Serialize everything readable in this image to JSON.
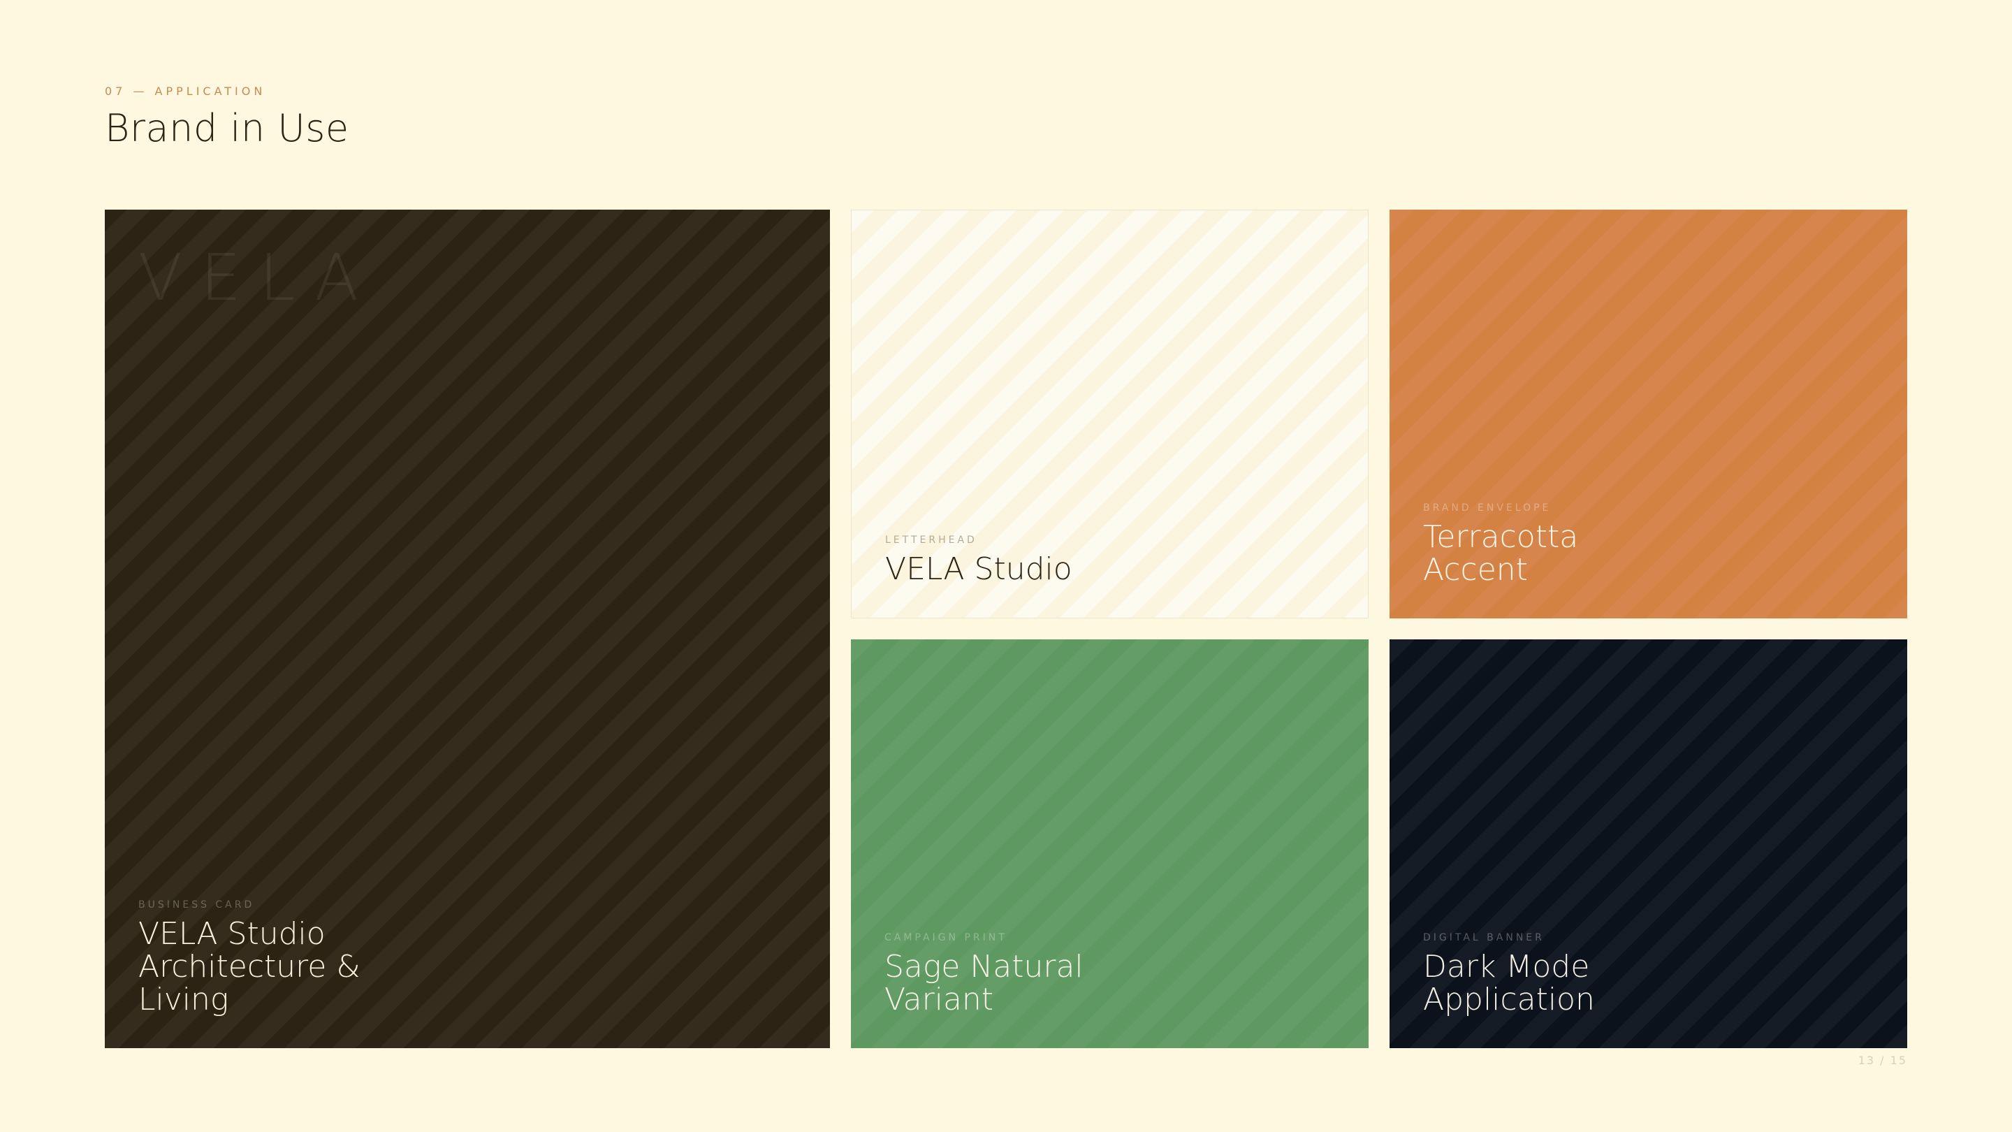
{
  "section": {
    "eyebrow": "07 — APPLICATION",
    "title": "Brand in Use"
  },
  "cards": {
    "business_card": {
      "watermark": "VELA",
      "label": "BUSINESS CARD",
      "title": "VELA Studio\nArchitecture &\nLiving",
      "background": "#2c2314"
    },
    "letterhead": {
      "label": "LETTERHEAD",
      "title": "VELA Studio",
      "background": "#fbf4df"
    },
    "brand_envelope": {
      "label": "BRAND ENVELOPE",
      "title": "Terracotta\nAccent",
      "background": "#d48144"
    },
    "campaign_print": {
      "label": "CAMPAIGN PRINT",
      "title": "Sage Natural\nVariant",
      "background": "#5d9961"
    },
    "digital_banner": {
      "label": "DIGITAL BANNER",
      "title": "Dark Mode\nApplication",
      "background": "#0b121b"
    }
  },
  "pagination": {
    "text": "13 / 15",
    "current": 13,
    "total": 15
  }
}
